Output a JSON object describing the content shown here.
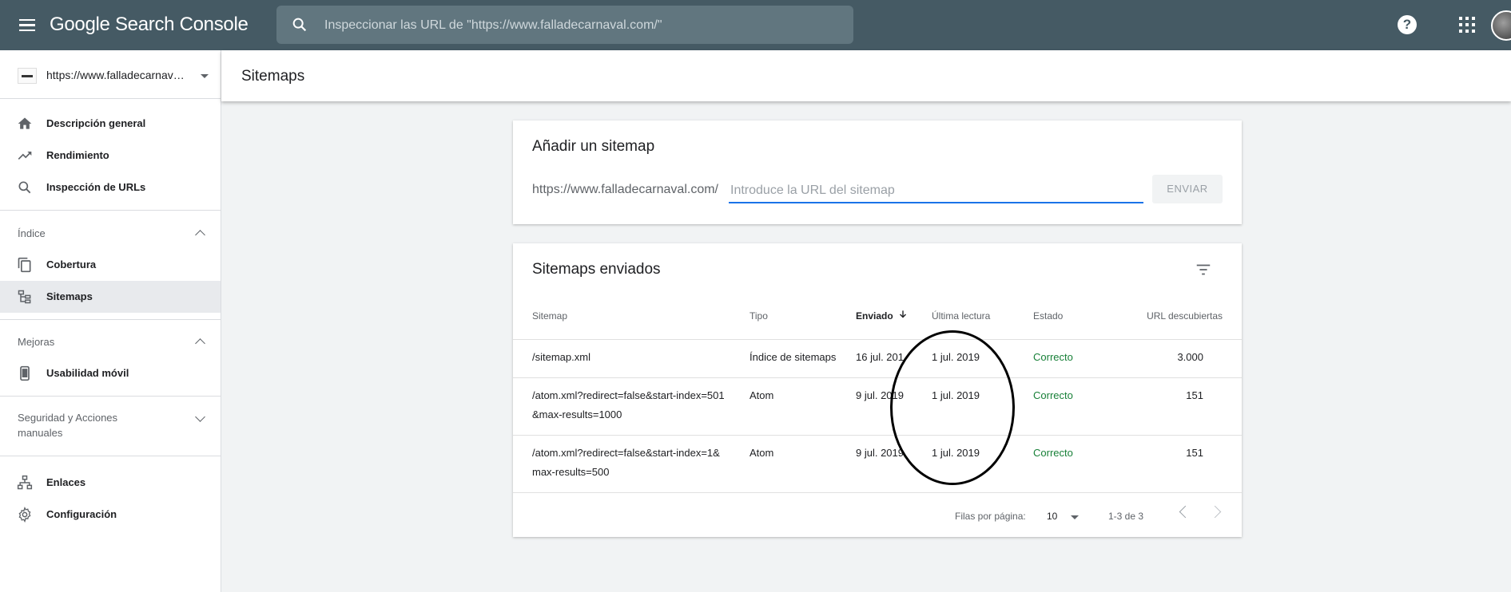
{
  "topbar": {
    "logo": "Google Search Console",
    "search_placeholder": "Inspeccionar las URL de \"https://www.falladecarnaval.com/\"",
    "help_symbol": "?"
  },
  "sidebar": {
    "property": "https://www.falladecarnaval.com/",
    "items_top": [
      {
        "label": "Descripción general",
        "icon": "home-icon"
      },
      {
        "label": "Rendimiento",
        "icon": "trending-up-icon"
      },
      {
        "label": "Inspección de URLs",
        "icon": "search-icon"
      }
    ],
    "section_index": "Índice",
    "items_index": [
      {
        "label": "Cobertura",
        "icon": "copy-icon"
      },
      {
        "label": "Sitemaps",
        "icon": "sitemap-icon"
      }
    ],
    "section_improvements": "Mejoras",
    "items_improvements": [
      {
        "label": "Usabilidad móvil",
        "icon": "phone-icon"
      }
    ],
    "section_security_line1": "Seguridad y Acciones",
    "section_security_line2": "manuales",
    "items_bottom": [
      {
        "label": "Enlaces",
        "icon": "links-icon"
      },
      {
        "label": "Configuración",
        "icon": "gear-icon"
      }
    ]
  },
  "header": {
    "title": "Sitemaps"
  },
  "add_sitemap": {
    "title": "Añadir un sitemap",
    "prefix": "https://www.falladecarnaval.com/",
    "input_placeholder": "Introduce la URL del sitemap",
    "submit_label": "ENVIAR"
  },
  "submitted": {
    "title": "Sitemaps enviados",
    "columns": [
      "Sitemap",
      "Tipo",
      "Enviado",
      "Última lectura",
      "Estado",
      "URL descubiertas"
    ],
    "rows": [
      {
        "sitemap_line1": "/sitemap.xml",
        "sitemap_line2": "",
        "type": "Índice de sitemaps",
        "submitted": "16 jul. 2019",
        "last_read": "1 jul. 2019",
        "status": "Correcto",
        "urls": "3.000"
      },
      {
        "sitemap_line1": "/atom.xml?redirect=false&start-index=501",
        "sitemap_line2": "&max-results=1000",
        "type": "Atom",
        "submitted": "9 jul. 2019",
        "last_read": "1 jul. 2019",
        "status": "Correcto",
        "urls": "151"
      },
      {
        "sitemap_line1": "/atom.xml?redirect=false&start-index=1&",
        "sitemap_line2": "max-results=500",
        "type": "Atom",
        "submitted": "9 jul. 2019",
        "last_read": "1 jul. 2019",
        "status": "Correcto",
        "urls": "151"
      }
    ],
    "rows_per_page_label": "Filas por página:",
    "rows_per_page": "10",
    "range": "1-3 de 3"
  }
}
